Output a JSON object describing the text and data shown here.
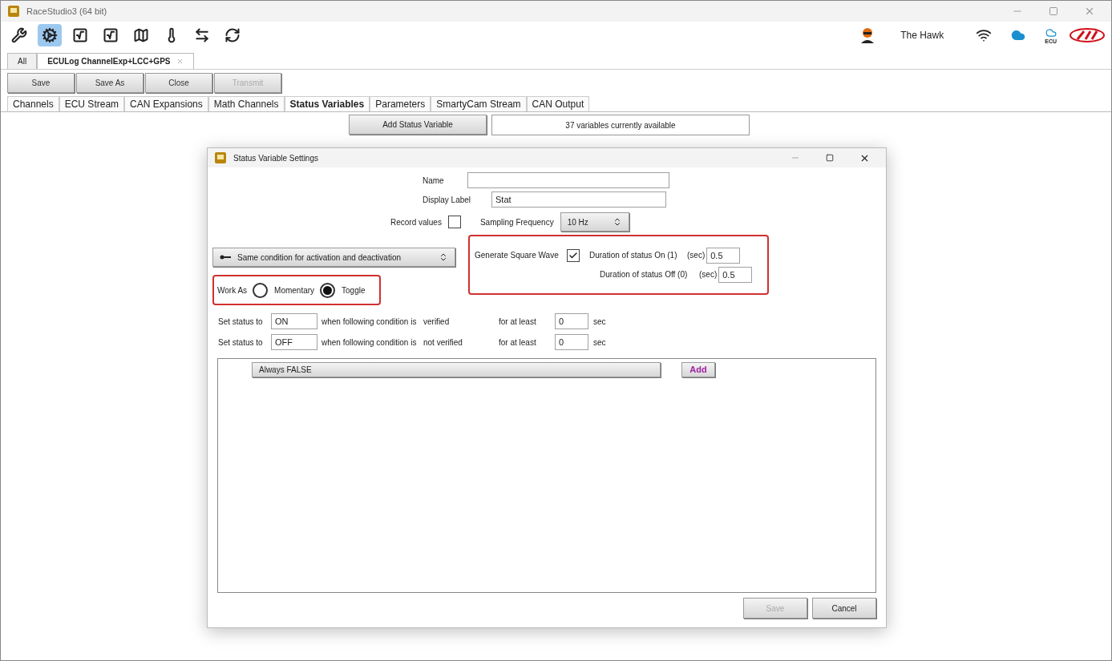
{
  "window": {
    "title": "RaceStudio3 (64 bit)"
  },
  "toolbar": [
    {
      "kind": "tools",
      "selected": false
    },
    {
      "kind": "settings",
      "selected": true
    },
    {
      "kind": "math2",
      "selected": false
    },
    {
      "kind": "math3",
      "selected": false
    },
    {
      "kind": "track",
      "selected": false
    },
    {
      "kind": "temperature",
      "selected": false
    },
    {
      "kind": "add-device",
      "selected": false
    },
    {
      "kind": "sync",
      "selected": false
    }
  ],
  "user": {
    "name": "The Hawk"
  },
  "status_icons": {
    "ecu_label": "ECU"
  },
  "doc_tabs": [
    {
      "label": "All",
      "selected": false,
      "closable": false
    },
    {
      "label": "ECULog ChannelExp+LCC+GPS",
      "selected": true,
      "closable": true
    }
  ],
  "actions": [
    {
      "label": "Save",
      "disabled": false
    },
    {
      "label": "Save As",
      "disabled": false
    },
    {
      "label": "Close",
      "disabled": false
    },
    {
      "label": "Transmit",
      "disabled": true
    }
  ],
  "section_tabs": [
    {
      "label": "Channels",
      "selected": false
    },
    {
      "label": "ECU Stream",
      "selected": false
    },
    {
      "label": "CAN Expansions",
      "selected": false
    },
    {
      "label": "Math Channels",
      "selected": false
    },
    {
      "label": "Status Variables",
      "selected": true
    },
    {
      "label": "Parameters",
      "selected": false
    },
    {
      "label": "SmartyCam Stream",
      "selected": false
    },
    {
      "label": "CAN Output",
      "selected": false
    }
  ],
  "add_button": "Add Status Variable",
  "available": "37 variables currently available",
  "dialog": {
    "title": "Status Variable Settings",
    "name": {
      "label": "Name"
    },
    "display_label": {
      "label": "Display Label",
      "value": "Stat"
    },
    "record": {
      "label": "Record values",
      "checked": false
    },
    "sampling": {
      "label": "Sampling Frequency",
      "value": "10 Hz"
    },
    "condition_mode": "Same condition for activation and deactivation",
    "square_wave": {
      "label": "Generate Square Wave",
      "checked": true,
      "on_label": "Duration of status On (1)",
      "on_unit": "(sec)",
      "on_value": "0.5",
      "off_label": "Duration of status Off (0)",
      "off_unit": "(sec)",
      "off_value": "0.5"
    },
    "work_as": {
      "label": "Work As",
      "options": [
        {
          "label": "Momentary",
          "selected": false
        },
        {
          "label": "Toggle",
          "selected": true
        }
      ]
    },
    "rules": [
      {
        "prefix": "Set status to",
        "value": "ON",
        "middle": "when following condition is",
        "condition": "verified",
        "for_label": "for at least",
        "duration": "0",
        "unit": "sec"
      },
      {
        "prefix": "Set status to",
        "value": "OFF",
        "middle": "when following condition is",
        "condition": "not verified",
        "for_label": "for at least",
        "duration": "0",
        "unit": "sec"
      }
    ],
    "condition": "Always FALSE",
    "add": "Add",
    "buttons": [
      {
        "label": "Save",
        "disabled": true
      },
      {
        "label": "Cancel",
        "disabled": false
      }
    ]
  }
}
